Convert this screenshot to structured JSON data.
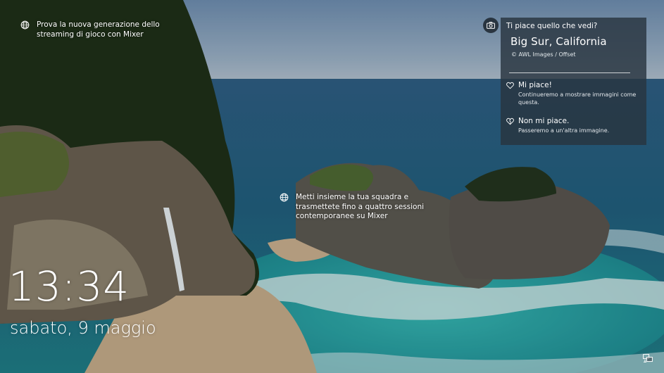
{
  "hotspots": {
    "top": {
      "icon": "globe-icon",
      "lines": [
        "Prova la nuova generazione dello",
        "streaming di gioco con Mixer"
      ]
    },
    "middle": {
      "icon": "globe-icon",
      "lines": [
        "Metti insieme la tua squadra e",
        "trasmettete fino a quattro sessioni",
        "contemporanee su Mixer"
      ]
    }
  },
  "spotlight": {
    "question": "Ti piace quello che vedi?",
    "location": "Big Sur, California",
    "credit": "© AWL Images / Offset",
    "like": {
      "icon": "heart-icon",
      "title": "Mi piace!",
      "description_lines": [
        "Continueremo a mostrare immagini come",
        "questa."
      ]
    },
    "dislike": {
      "icon": "heart-broken-icon",
      "title": "Non mi piace.",
      "description_lines": [
        "Passeremo a un'altra immagine."
      ]
    }
  },
  "lockscreen": {
    "time": "13:34",
    "date": "sabato, 9 maggio"
  },
  "status": {
    "network_icon": "network-icon"
  }
}
